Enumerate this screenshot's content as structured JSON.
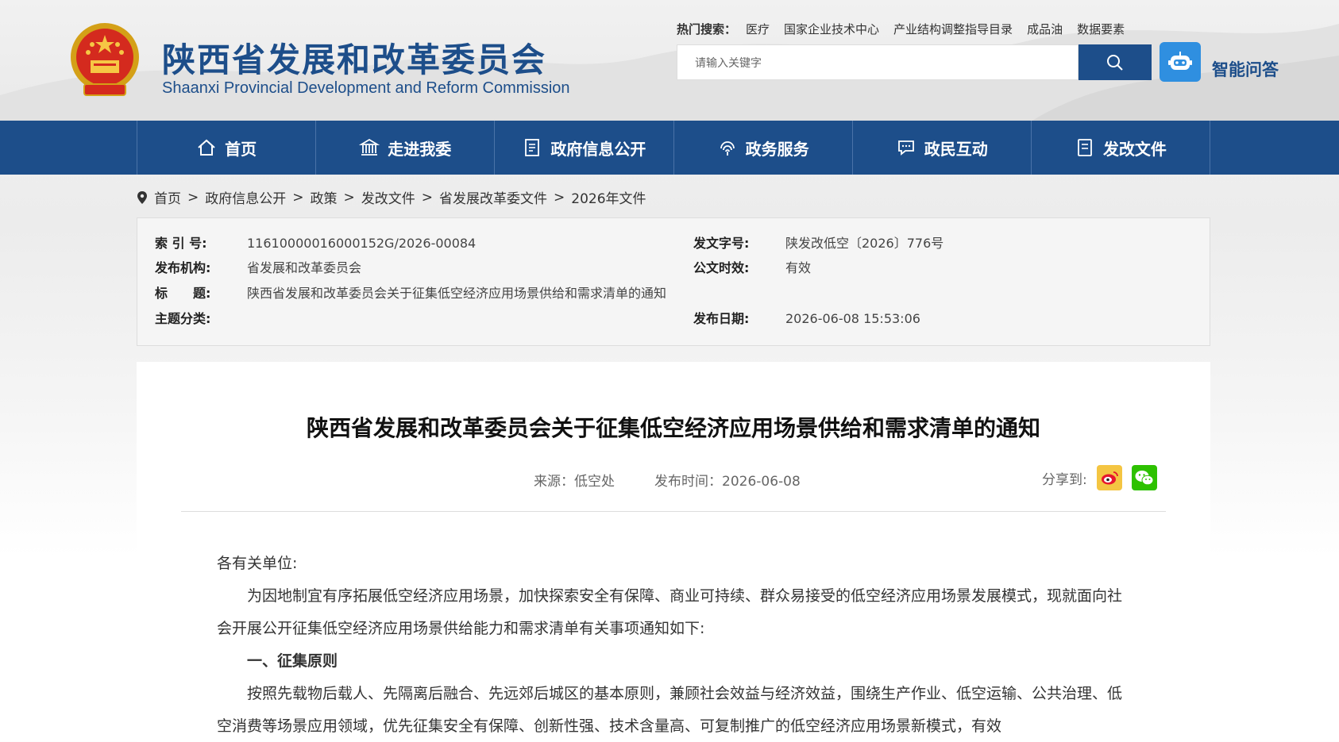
{
  "header": {
    "logo_cn": "陕西省发展和改革委员会",
    "logo_en": "Shaanxi Provincial Development and Reform Commission",
    "hot_title": "热门搜索：",
    "hot_links": [
      "医疗",
      "国家企业技术中心",
      "产业结构调整指导目录",
      "成品油",
      "数据要素"
    ],
    "search_placeholder": "请输入关键字",
    "ai_label": "智能问答",
    "brand_color": "#1d4e8a"
  },
  "nav": {
    "items": [
      {
        "label": "首页",
        "icon": "home-icon"
      },
      {
        "label": "走进我委",
        "icon": "building-icon"
      },
      {
        "label": "政府信息公开",
        "icon": "document-icon"
      },
      {
        "label": "政务服务",
        "icon": "fingerprint-icon"
      },
      {
        "label": "政民互动",
        "icon": "chat-icon"
      },
      {
        "label": "发改文件",
        "icon": "file-icon"
      }
    ]
  },
  "breadcrumb": [
    "首页",
    "政府信息公开",
    "政策",
    "发改文件",
    "省发展改革委文件",
    "2026年文件"
  ],
  "info": {
    "index_label": "索 引 号:",
    "index_value": "11610000016000152G/2026-00084",
    "docno_label": "发文字号:",
    "docno_value": "陕发改低空〔2026〕776号",
    "org_label": "发布机构:",
    "org_value": "省发展和改革委员会",
    "validity_label": "公文时效:",
    "validity_value": "有效",
    "title_label": "标　　题:",
    "title_value": "陕西省发展和改革委员会关于征集低空经济应用场景供给和需求清单的通知",
    "topic_label": "主题分类:",
    "topic_value": "",
    "date_label": "发布日期:",
    "date_value": "2026-06-08 15:53:06"
  },
  "article": {
    "title": "陕西省发展和改革委员会关于征集低空经济应用场景供给和需求清单的通知",
    "source": "来源：低空处",
    "pubtime": "发布时间：2026-06-08",
    "share_label": "分享到:",
    "salutation": "各有关单位:",
    "para1": "为因地制宜有序拓展低空经济应用场景，加快探索安全有保障、商业可持续、群众易接受的低空经济应用场景发展模式，现就面向社会开展公开征集低空经济应用场景供给能力和需求清单有关事项通知如下:",
    "heading1": "一、征集原则",
    "para2": "按照先载物后载人、先隔离后融合、先远郊后城区的基本原则，兼顾社会效益与经济效益，围绕生产作业、低空运输、公共治理、低空消费等场景应用领域，优先征集安全有保障、创新性强、技术含量高、可复制推广的低空经济应用场景新模式，有效"
  }
}
